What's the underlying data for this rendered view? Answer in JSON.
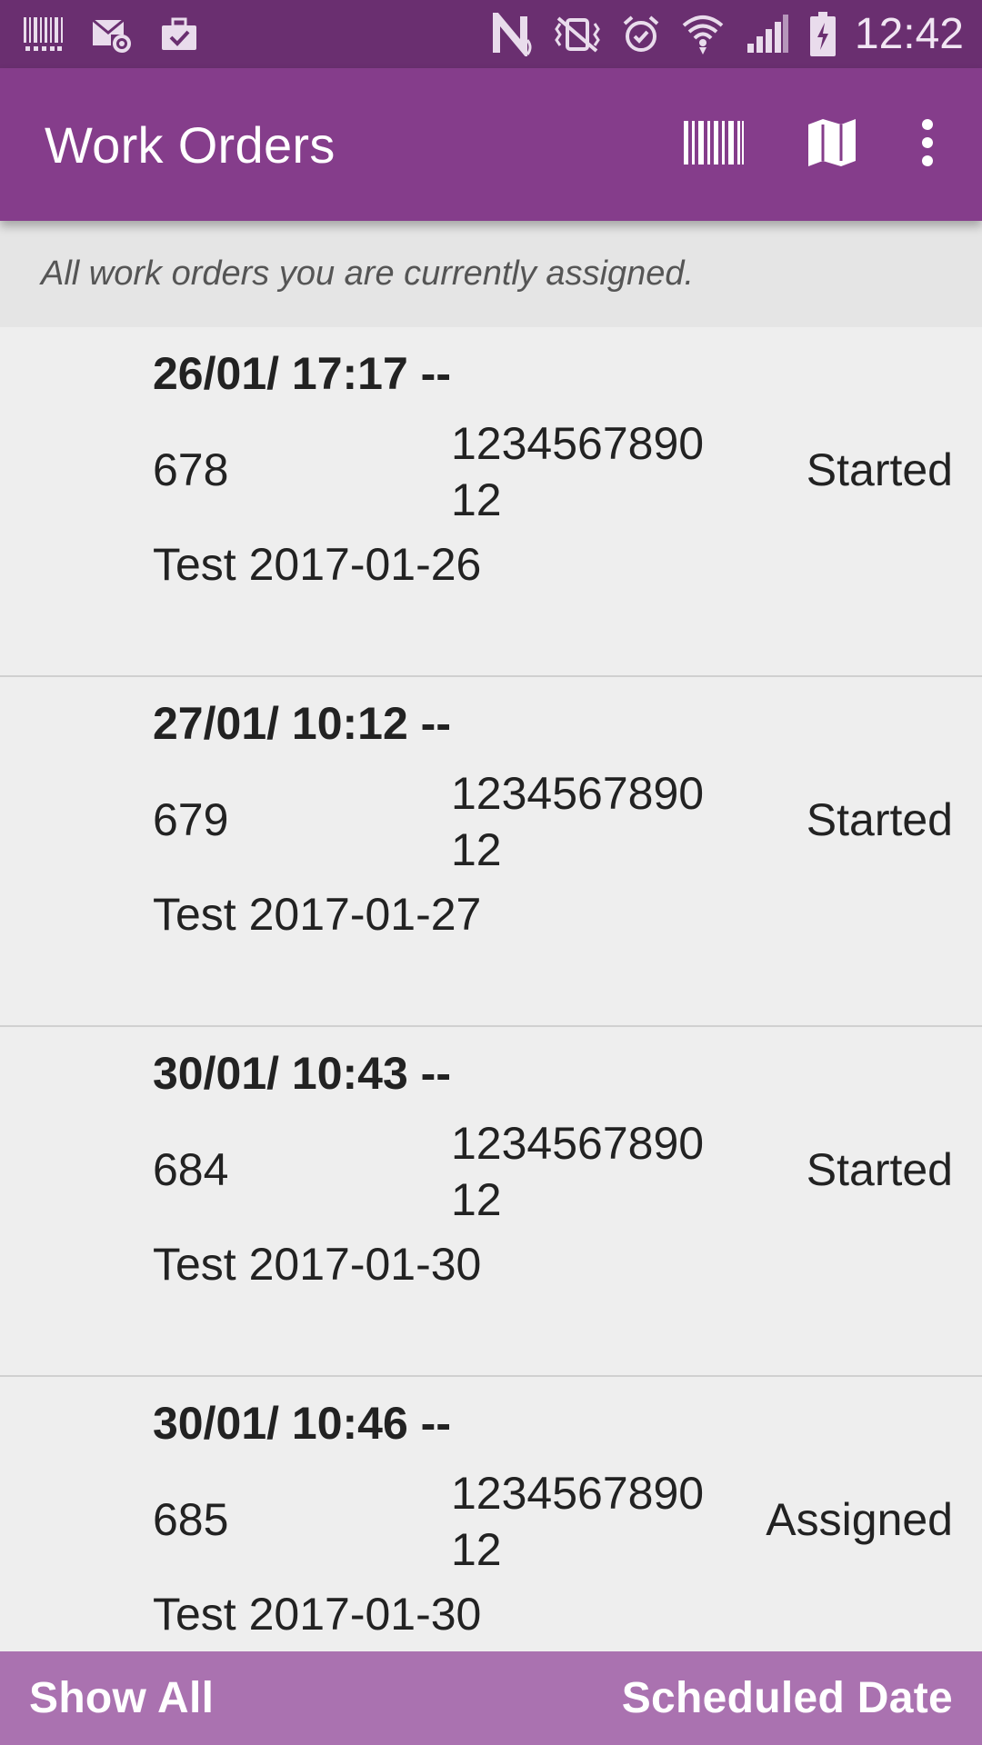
{
  "status_bar": {
    "time": "12:42",
    "left_icons": [
      "barcode-notification-icon",
      "mail-settings-icon",
      "briefcase-check-icon"
    ],
    "right_icons": [
      "nfc-icon",
      "vibrate-icon",
      "alarm-icon",
      "wifi-icon",
      "signal-icon",
      "battery-charging-icon"
    ]
  },
  "app_bar": {
    "title": "Work Orders",
    "actions": [
      "barcode-icon",
      "map-icon",
      "more-vert-icon"
    ]
  },
  "subtitle": "All work orders you are currently assigned.",
  "orders": [
    {
      "date": "26/01/ 17:17 --",
      "id": "678",
      "ref": "123456789012",
      "status": "Started",
      "desc": "Test 2017-01-26"
    },
    {
      "date": "27/01/ 10:12 --",
      "id": "679",
      "ref": "123456789012",
      "status": "Started",
      "desc": "Test 2017-01-27"
    },
    {
      "date": "30/01/ 10:43 --",
      "id": "684",
      "ref": "123456789012",
      "status": "Started",
      "desc": "Test 2017-01-30"
    },
    {
      "date": "30/01/ 10:46 --",
      "id": "685",
      "ref": "123456789012",
      "status": "Assigned",
      "desc": "Test 2017-01-30"
    }
  ],
  "bottom_bar": {
    "left": "Show All",
    "right": "Scheduled Date"
  },
  "colors": {
    "status_bar": "#6a2f70",
    "app_bar": "#853d8b",
    "bottom_bar": "#aa72b0",
    "background": "#eeeeee"
  }
}
